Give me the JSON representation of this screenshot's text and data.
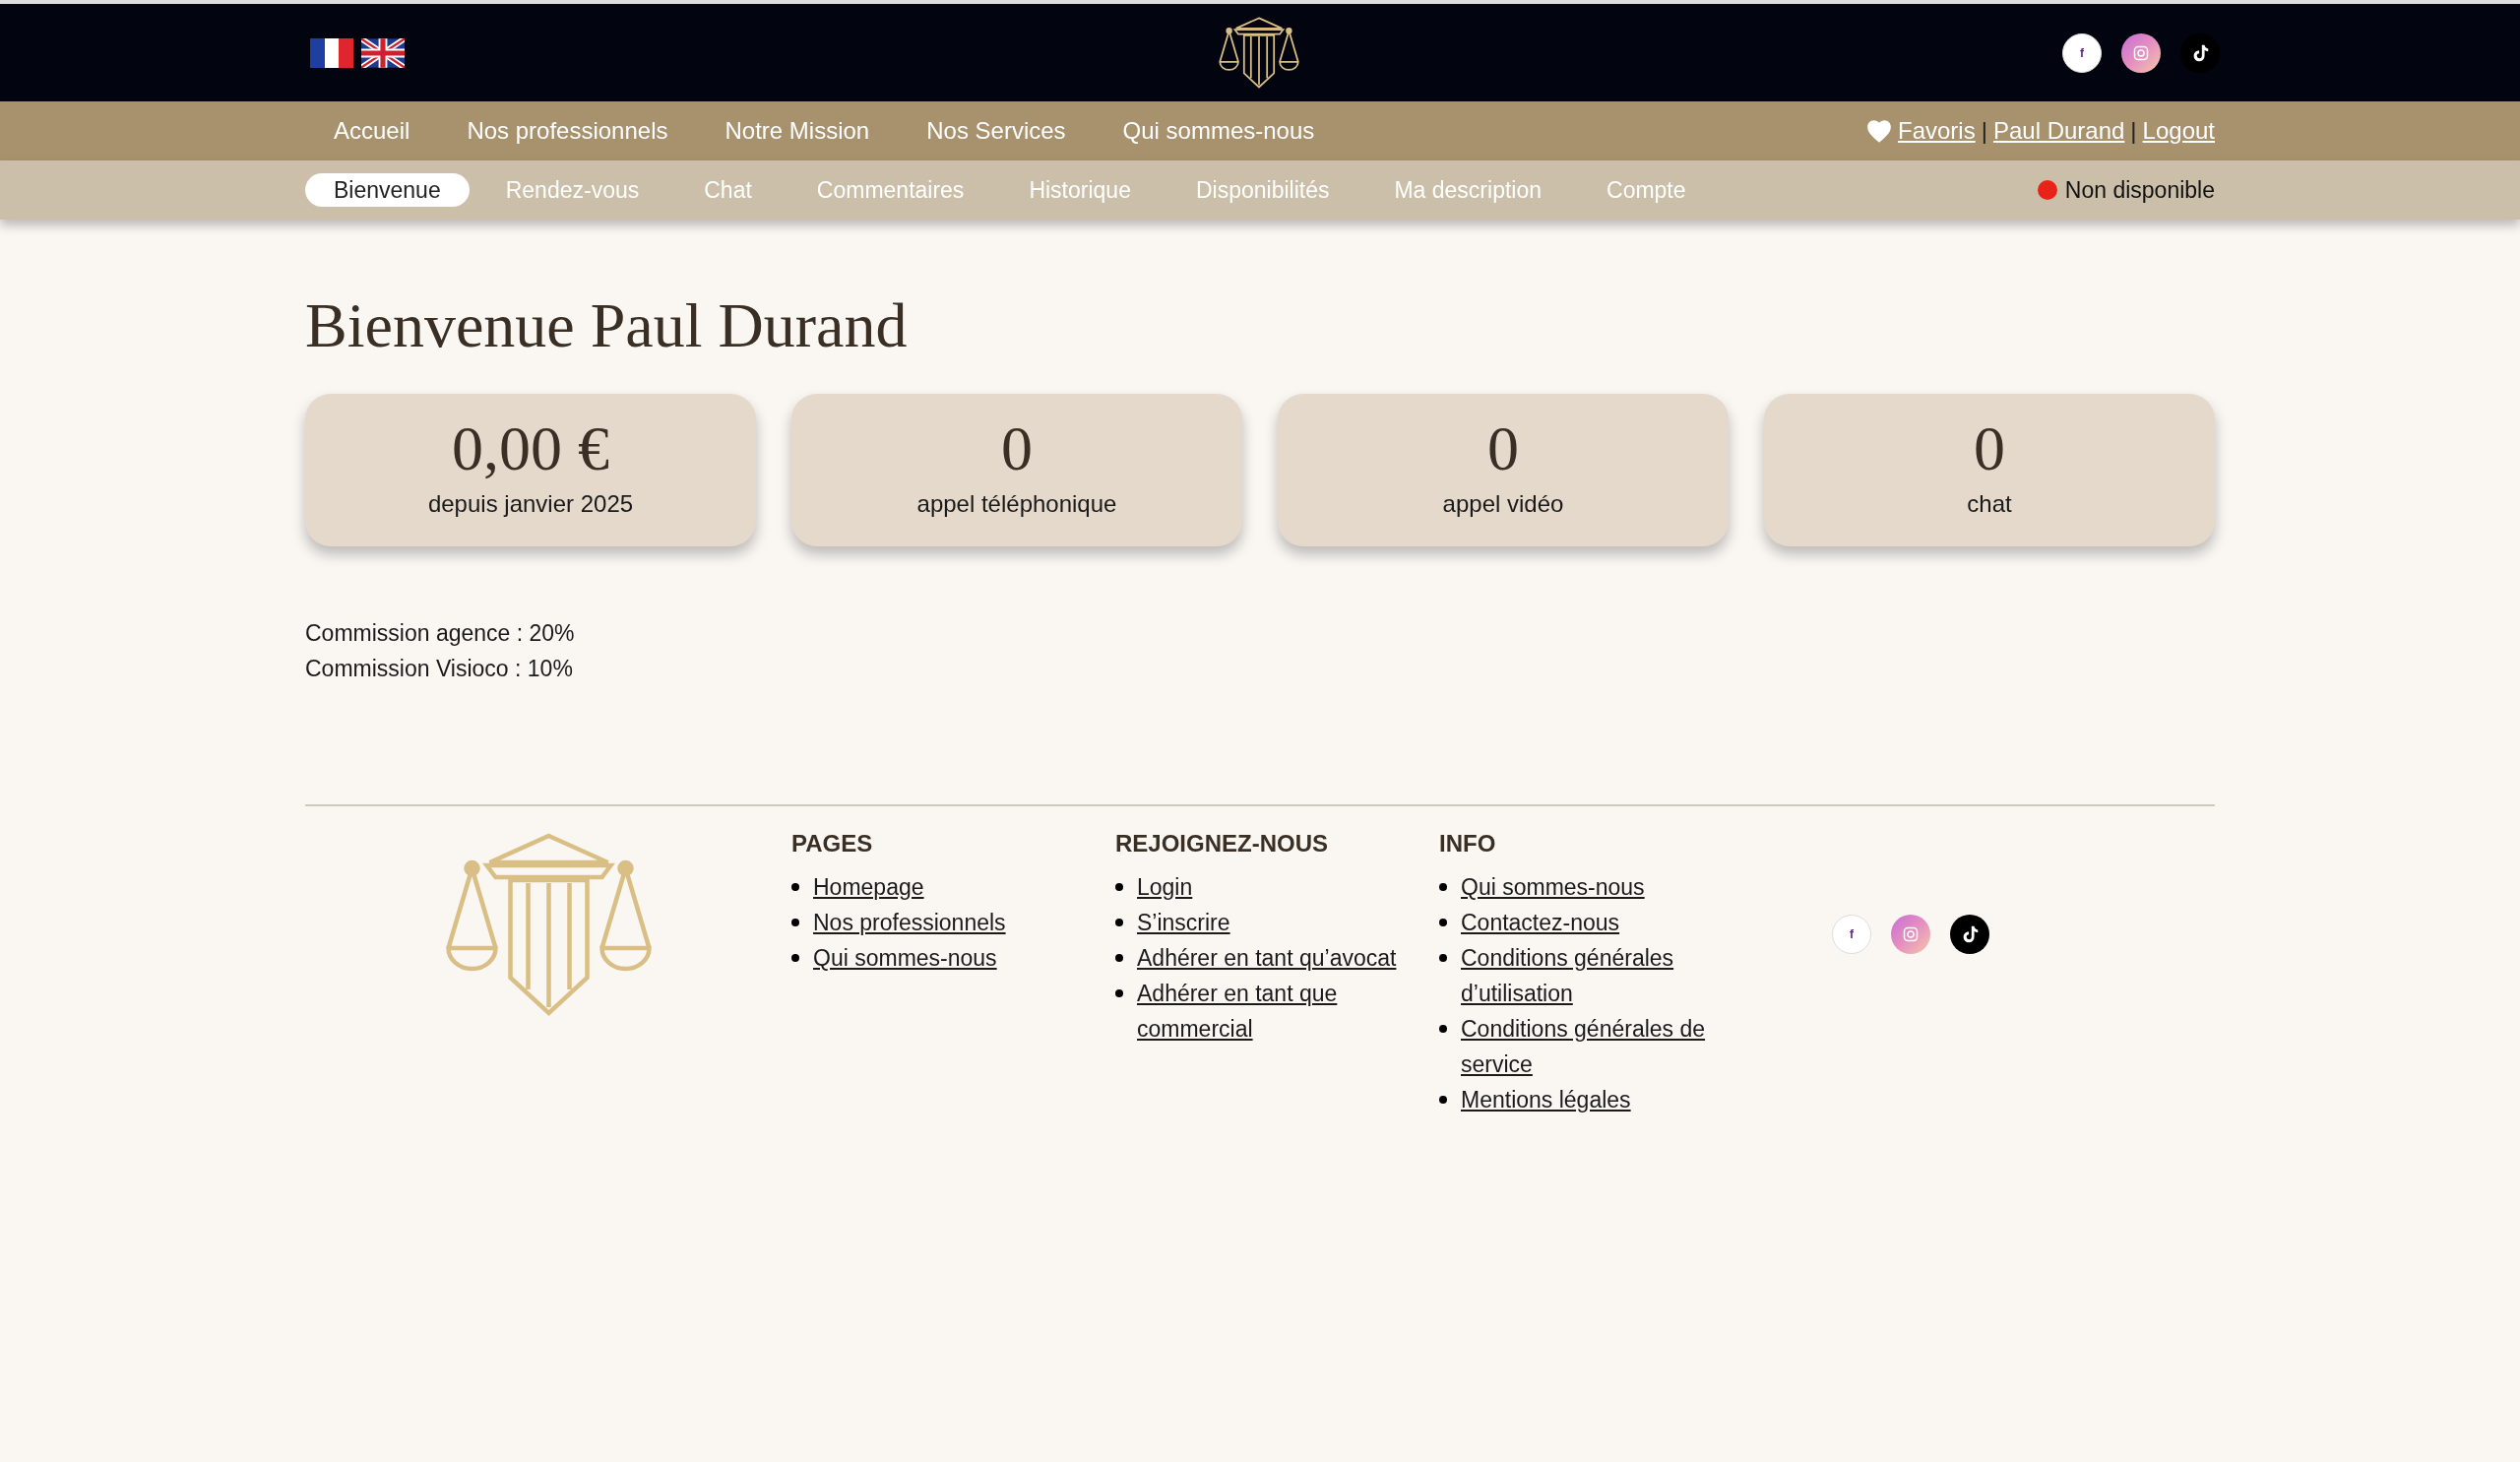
{
  "header": {
    "languages": [
      {
        "kind": "fr"
      },
      {
        "kind": "en"
      }
    ],
    "social": [
      {
        "kind": "facebook",
        "label": "f"
      },
      {
        "kind": "instagram"
      },
      {
        "kind": "tiktok"
      }
    ]
  },
  "main_nav": {
    "items": [
      "Accueil",
      "Nos professionnels",
      "Notre Mission",
      "Nos Services",
      "Qui sommes-nous"
    ],
    "favorites": "Favoris",
    "separator": "|",
    "user": "Paul Durand",
    "logout": "Logout"
  },
  "sub_nav": {
    "tabs": [
      {
        "label": "Bienvenue",
        "selected": true
      },
      {
        "label": "Rendez-vous",
        "selected": false
      },
      {
        "label": "Chat",
        "selected": false
      },
      {
        "label": "Commentaires",
        "selected": false
      },
      {
        "label": "Historique",
        "selected": false
      },
      {
        "label": "Disponibilités",
        "selected": false
      },
      {
        "label": "Ma description",
        "selected": false
      },
      {
        "label": "Compte",
        "selected": false
      }
    ],
    "status": {
      "label": "Non disponible",
      "color": "#e8231a"
    }
  },
  "title": "Bienvenue Paul Durand",
  "stats": [
    {
      "value": "0,00 €",
      "label": "depuis janvier 2025"
    },
    {
      "value": "0",
      "label": "appel téléphonique"
    },
    {
      "value": "0",
      "label": "appel vidéo"
    },
    {
      "value": "0",
      "label": "chat"
    }
  ],
  "commissions": [
    "Commission agence : 20%",
    "Commission Visioco : 10%"
  ],
  "footer": {
    "columns": [
      {
        "title": "PAGES",
        "links": [
          "Homepage",
          "Nos professionnels",
          "Qui sommes-nous"
        ]
      },
      {
        "title": "REJOIGNEZ-NOUS",
        "links": [
          "Login",
          "S’inscrire",
          "Adhérer en tant qu’avocat",
          "Adhérer en tant que commercial"
        ]
      },
      {
        "title": "INFO",
        "links": [
          "Qui sommes-nous",
          "Contactez-nous",
          "Conditions générales d’utilisation",
          "Conditions générales de service",
          "Mentions légales"
        ]
      }
    ],
    "social": [
      {
        "kind": "facebook",
        "label": "f"
      },
      {
        "kind": "instagram"
      },
      {
        "kind": "tiktok"
      }
    ]
  }
}
